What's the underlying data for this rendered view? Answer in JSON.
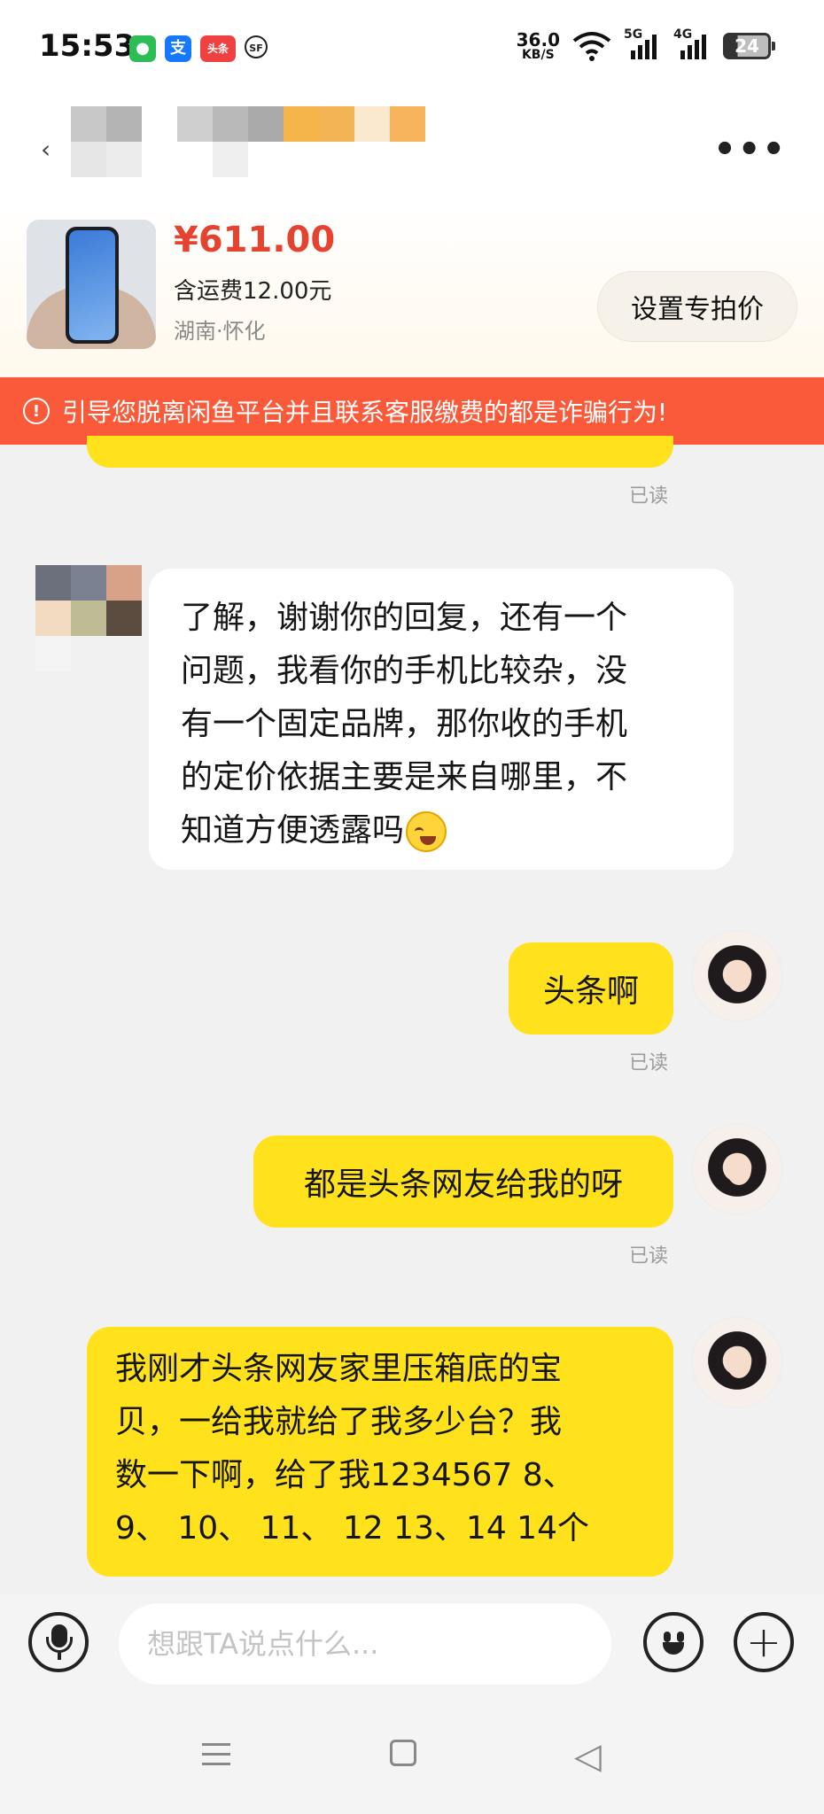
{
  "status_bar": {
    "time": "15:53",
    "apps": [
      {
        "icon": "wechat-icon",
        "glyph": "●",
        "color": "#2dbd55"
      },
      {
        "icon": "alipay-icon",
        "glyph": "支",
        "color": "#1677ff"
      },
      {
        "icon": "toutiao-icon",
        "glyph": "头条",
        "color": "#f04142"
      },
      {
        "icon": "sf-express-icon",
        "glyph": "SF",
        "color": "#222222"
      }
    ],
    "net_speed": "36.0",
    "net_speed_unit": "KB/S",
    "signal_5g": "5G",
    "signal_4g": "4G",
    "battery": "24"
  },
  "header": {
    "back_icon": "chevron-left-icon",
    "more_icon": "more-dots-icon",
    "more_glyph": "•••"
  },
  "product": {
    "price": "¥611.00",
    "shipping": "含运费12.00元",
    "location": "湖南·怀化",
    "special_price_button": "设置专拍价"
  },
  "warning": {
    "icon": "alert-circle-icon",
    "icon_glyph": "!",
    "text": "引导您脱离闲鱼平台并且联系客服缴费的都是诈骗行为!"
  },
  "messages": {
    "read_label": "已读",
    "received_1": {
      "lines": [
        "了解，谢谢你的回复，还有一个",
        "问题，我看你的手机比较杂，没",
        "有一个固定品牌，那你收的手机",
        "的定价依据主要是来自哪里，不"
      ],
      "last_line": "知道方便透露吗",
      "emoji": "crying-emoji-icon"
    },
    "sent_1": "头条啊",
    "sent_2": "都是头条网友给我的呀",
    "sent_3": {
      "lines": [
        "我刚才头条网友家里压箱底的宝",
        "贝，一给我就给了我多少台？我",
        "数一下啊，给了我1234567 8、",
        "9、 10、 11、 12 13、14 14个"
      ]
    }
  },
  "input_bar": {
    "placeholder": "想跟TA说点什么...",
    "mic_icon": "microphone-icon",
    "emoji_icon": "emoji-icon",
    "plus_icon": "plus-icon",
    "plus_glyph": "+"
  },
  "nav_bar": {
    "menu_icon": "menu-icon",
    "home_icon": "home-square-icon",
    "back_icon": "back-triangle-icon",
    "back_glyph": "◁"
  }
}
